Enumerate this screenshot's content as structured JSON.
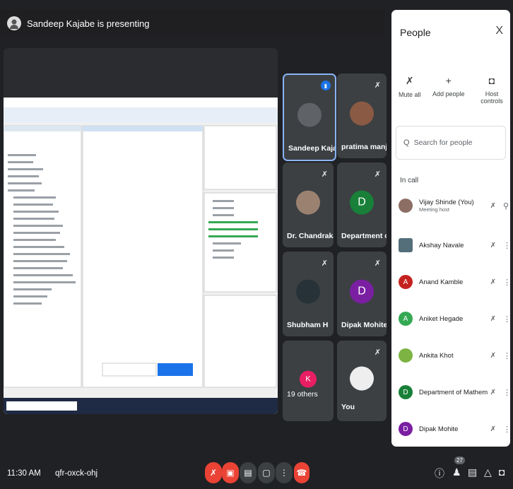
{
  "presentation": {
    "title": "Sandeep Kajabe is presenting"
  },
  "tiles": [
    {
      "name": "Sandeep Kajabe",
      "initial": "",
      "color": "#5f6368",
      "speaking": true
    },
    {
      "name": "pratima manjare...",
      "initial": "",
      "color": "#8a5a44",
      "muted": true
    },
    {
      "name": "Dr. Chandrakant ...",
      "initial": "",
      "color": "#9a8170",
      "muted": true
    },
    {
      "name": "Department of ...",
      "initial": "D",
      "color": "#188038",
      "muted": true
    },
    {
      "name": "Shubham H",
      "initial": "",
      "color": "#263238",
      "muted": true
    },
    {
      "name": "Dipak Mohite",
      "initial": "D",
      "color": "#7b1fa2",
      "muted": true
    },
    {
      "name": "19 others",
      "initial": "K",
      "color": "#e91e63",
      "muted": true
    },
    {
      "name": "You",
      "initial": "",
      "color": "#1a73e8"
    }
  ],
  "people": {
    "title": "People",
    "close": "X",
    "actions": {
      "mute_all": "Mute all",
      "add_people": "Add people",
      "host_controls": "Host controls"
    },
    "search_placeholder": "Search for people",
    "in_call_label": "In call",
    "participants": [
      {
        "name": "Vijay Shinde (You)",
        "sub": "Meeting host",
        "initial": "",
        "color": "#8d6e63"
      },
      {
        "name": "Akshay Navale",
        "initial": "",
        "color": "#546e7a"
      },
      {
        "name": "Anand Kamble",
        "initial": "A",
        "color": "#c5221f"
      },
      {
        "name": "Aniket Hegade",
        "initial": "A",
        "color": "#34a853"
      },
      {
        "name": "Ankita Khot",
        "initial": "",
        "color": "#7cb342"
      },
      {
        "name": "Department of Mathemat...",
        "initial": "D",
        "color": "#188038"
      },
      {
        "name": "Dipak Mohite",
        "initial": "D",
        "color": "#7b1fa2"
      }
    ]
  },
  "footer": {
    "time": "11:30 AM",
    "meeting_code": "qfr-oxck-ohj",
    "people_count": "27"
  }
}
